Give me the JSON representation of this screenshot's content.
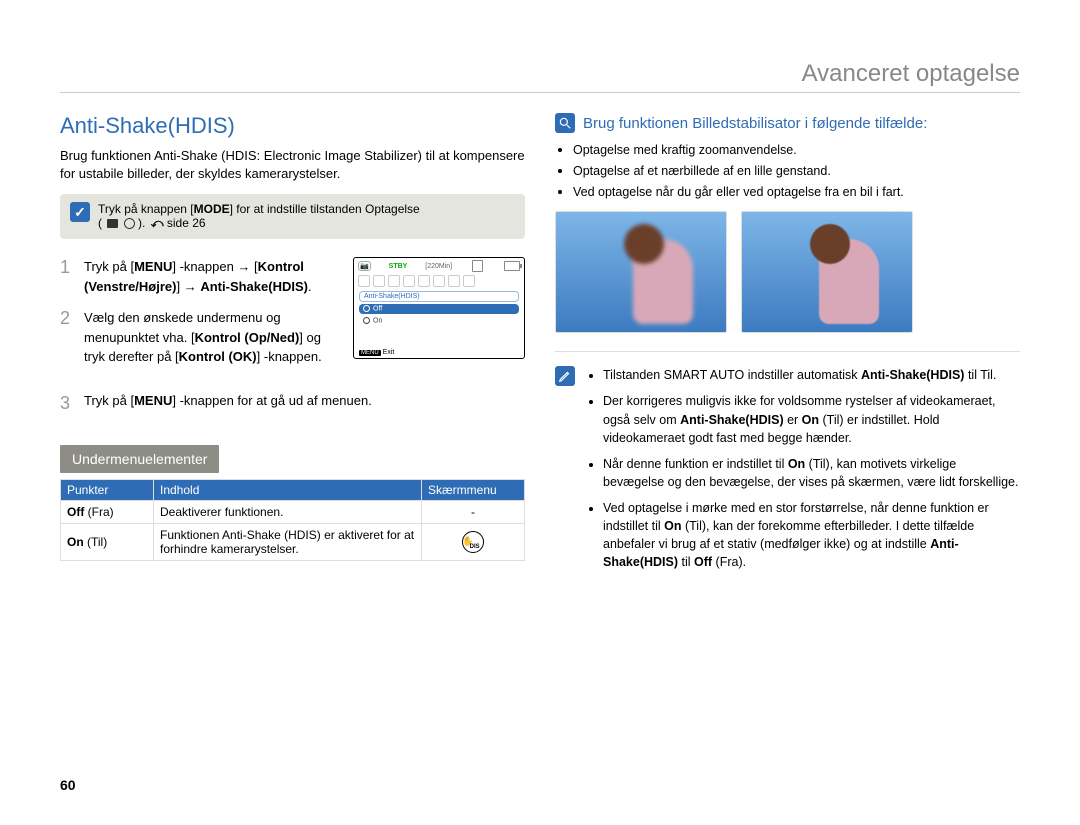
{
  "header": {
    "title": "Avanceret optagelse"
  },
  "section_title": "Anti-Shake(HDIS)",
  "intro": "Brug funktionen Anti-Shake (HDIS: Electronic Image Stabilizer) til at kompensere for ustabile billeder, der skyldes kamerarystelser.",
  "tip_mode_prefix": "Tryk på knappen [",
  "tip_mode_bold": "MODE",
  "tip_mode_suffix": "] for at indstille tilstanden Optagelse",
  "tip_mode_line2_prefix": "(",
  "tip_mode_line2_suffix": "). ",
  "tip_mode_page_ref": "side 26",
  "steps": [
    {
      "num": "1",
      "parts": [
        "Tryk på [",
        "MENU",
        "] -knappen ",
        "→",
        " [",
        "Kontrol (Venstre/Højre)",
        "] ",
        "→",
        " ",
        "Anti-Shake(HDIS)",
        "."
      ]
    },
    {
      "num": "2",
      "parts": [
        "Vælg den ønskede undermenu og menupunktet vha. [",
        "Kontrol (Op/Ned)",
        "] og tryk derefter på [",
        "Kontrol (OK)",
        "] -knappen."
      ]
    },
    {
      "num": "3",
      "parts": [
        "Tryk på [",
        "MENU",
        "] -knappen for at gå ud af menuen."
      ]
    }
  ],
  "lcd": {
    "stby": "STBY",
    "time": "[220Min]",
    "title": "Anti-Shake(HDIS)",
    "off": "Off",
    "on": "On",
    "menu": "MENU",
    "exit": "Exit"
  },
  "submenu_header": "Undermenuelementer",
  "table": {
    "headers": [
      "Punkter",
      "Indhold",
      "Skærmmenu"
    ],
    "rows": [
      {
        "item_bold": "Off",
        "item_paren": " (Fra)",
        "desc": "Deaktiverer funktionen.",
        "screen": "-"
      },
      {
        "item_bold": "On",
        "item_paren": " (Til)",
        "desc": "Funktionen Anti-Shake (HDIS) er aktiveret for at forhindre kamerarystelser.",
        "screen": "icon"
      }
    ]
  },
  "right_header": "Brug funktionen Billedstabilisator i følgende tilfælde:",
  "right_bullets": [
    "Optagelse med kraftig zoomanvendelse.",
    "Optagelse af et nærbillede af en lille genstand.",
    "Ved optagelse når du går eller ved optagelse fra en bil i fart."
  ],
  "notes": [
    {
      "pre": "Tilstanden SMART AUTO indstiller automatisk ",
      "bold": "Anti-Shake(HDIS)",
      "post": " til Til."
    },
    {
      "pre": "Der korrigeres muligvis ikke for voldsomme rystelser af videokameraet, også selv om ",
      "bold": "Anti-Shake(HDIS)",
      "mid": " er ",
      "bold2": "On",
      "post": " (Til) er indstillet. Hold videokameraet godt fast med begge hænder."
    },
    {
      "pre": "Når denne funktion er indstillet til ",
      "bold": "On",
      "post": " (Til), kan motivets virkelige bevægelse og den bevægelse, der vises på skærmen, være lidt forskellige."
    },
    {
      "pre": "Ved optagelse i mørke med en stor forstørrelse, når denne funktion er indstillet til ",
      "bold": "On",
      "mid": " (Til), kan der forekomme efterbilleder. I dette tilfælde anbefaler vi brug af et stativ (medfølger ikke) og at indstille ",
      "bold2": "Anti-Shake(HDIS)",
      "mid2": " til ",
      "bold3": "Off",
      "post": " (Fra)."
    }
  ],
  "page_num": "60",
  "hand_icon_text": "DIS"
}
